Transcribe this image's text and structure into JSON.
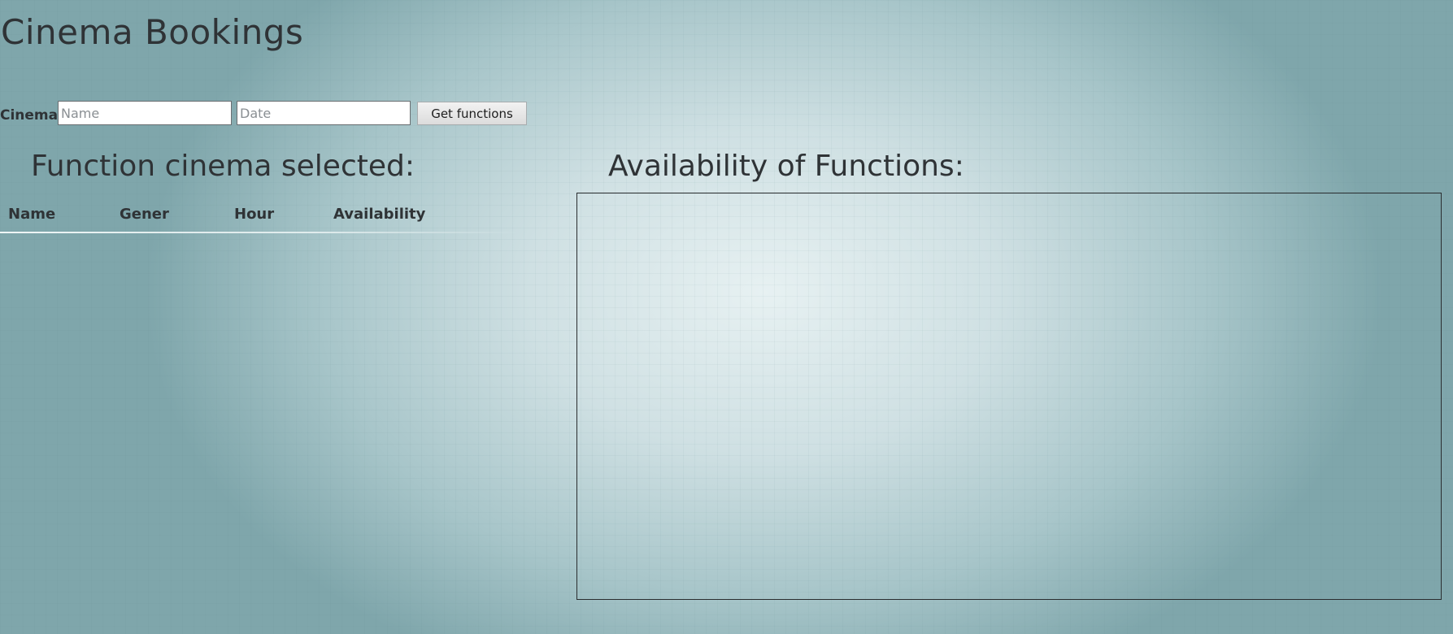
{
  "page": {
    "title": "Cinema Bookings"
  },
  "form": {
    "cinema_label": "Cinema:",
    "name_input": {
      "value": "",
      "placeholder": "Name"
    },
    "date_input": {
      "value": "",
      "placeholder": "Date"
    },
    "submit_label": "Get functions"
  },
  "functions_section": {
    "title": "Function cinema selected:",
    "columns": [
      "Name",
      "Gener",
      "Hour",
      "Availability"
    ],
    "rows": []
  },
  "availability_section": {
    "title": "Availability of Functions:"
  },
  "colors": {
    "text": "#2f3336",
    "background_center": "#e7f1f2",
    "background_edge": "#7fa6ab",
    "canvas_border": "#2a2d2f"
  }
}
